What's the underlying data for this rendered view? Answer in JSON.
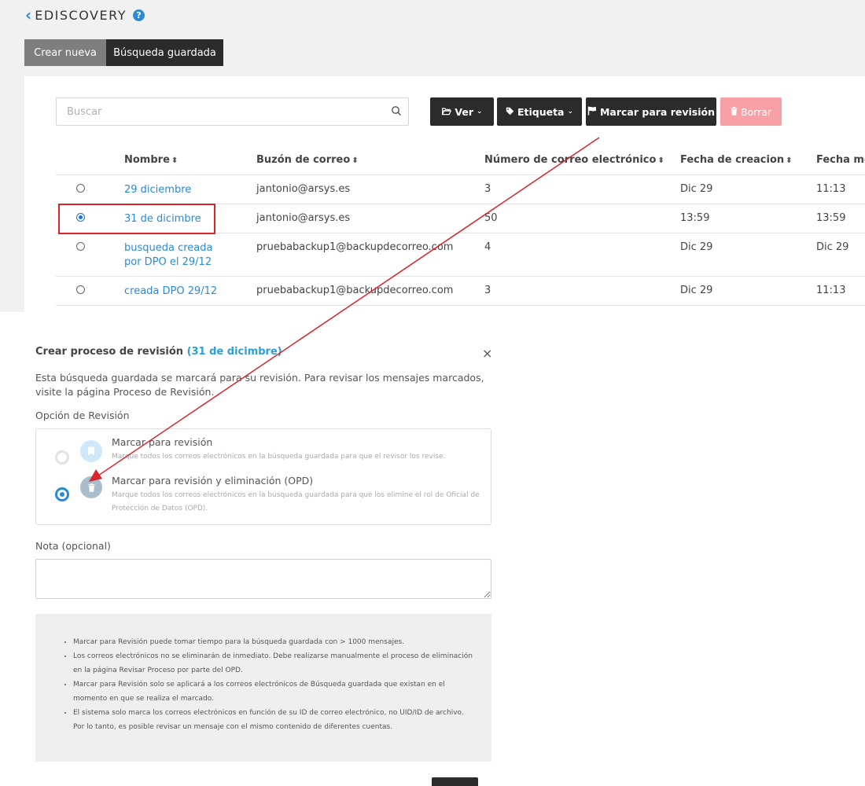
{
  "header": {
    "title": "EDISCOVERY"
  },
  "tabs": [
    {
      "label": "Crear nueva"
    },
    {
      "label": "Búsqueda guardada"
    }
  ],
  "search": {
    "placeholder": "Buscar",
    "value": ""
  },
  "toolbar": {
    "ver_label": "Ver",
    "etiqueta_label": "Etiqueta",
    "marcar_label": "Marcar para revisión",
    "borrar_label": "Borrar"
  },
  "table": {
    "columns": [
      "Nombre",
      "Buzón de correo",
      "Número de correo electrónico",
      "Fecha de creacion",
      "Fecha mo"
    ],
    "rows": [
      {
        "name": "29 diciembre",
        "mailbox": "jantonio@arsys.es",
        "count": "3",
        "created": "Dic 29",
        "modified": "11:13",
        "selected": false
      },
      {
        "name": "31 de dicimbre",
        "mailbox": "jantonio@arsys.es",
        "count": "50",
        "created": "13:59",
        "modified": "13:59",
        "selected": true
      },
      {
        "name": "busqueda creada por DPO el 29/12",
        "mailbox": "pruebabackup1@backupdecorreo.com",
        "count": "4",
        "created": "Dic 29",
        "modified": "Dic 29",
        "selected": false
      },
      {
        "name": "creada DPO 29/12",
        "mailbox": "pruebabackup1@backupdecorreo.com",
        "count": "3",
        "created": "Dic 29",
        "modified": "11:13",
        "selected": false
      }
    ]
  },
  "modal": {
    "title": "Crear proceso de revisión",
    "title_accent": "(31 de dicimbre)",
    "close": "×",
    "description": "Esta búsqueda guardada se marcará para su revisión. Para revisar los mensajes marcados, visite la página Proceso de Revisión.",
    "option_label": "Opción de Revisión",
    "options": [
      {
        "title": "Marcar para revisión",
        "subtitle": "Marque todos los correos electrónicos en la búsqueda guardada para que el revisor los revise.",
        "selected": false
      },
      {
        "title": "Marcar para revisión y eliminación (OPD)",
        "subtitle": "Marque todos los correos electrónicos en la búsqueda guardada para que los elimine el rol de Oficial de Protección de Datos (OPD).",
        "selected": true
      }
    ],
    "note_label": "Nota (opcional)",
    "note_value": "",
    "info": [
      "Marcar para Revisión puede tomar tiempo para la búsqueda guardada con > 1000 mensajes.",
      "Los correos electrónicos no se eliminarán de inmediato. Debe realizarse manualmente el proceso de eliminación en la página Revisar Proceso por parte del OPD.",
      "Marcar para Revisión solo se aplicará a los correos electrónicos de Búsqueda guardada que existan en el momento en que se realiza el marcado.",
      "El sistema solo marca los correos electrónicos en función de su ID de correo electrónico, no UID/ID de archivo. Por lo tanto, es posible revisar un mensaje con el mismo contenido de diferentes cuentas."
    ]
  },
  "colors": {
    "accent": "#2b8ad6",
    "dark_button": "#2b2b2b",
    "delete_button": "#f9a0a7",
    "annotation_red": "#d9252a"
  }
}
